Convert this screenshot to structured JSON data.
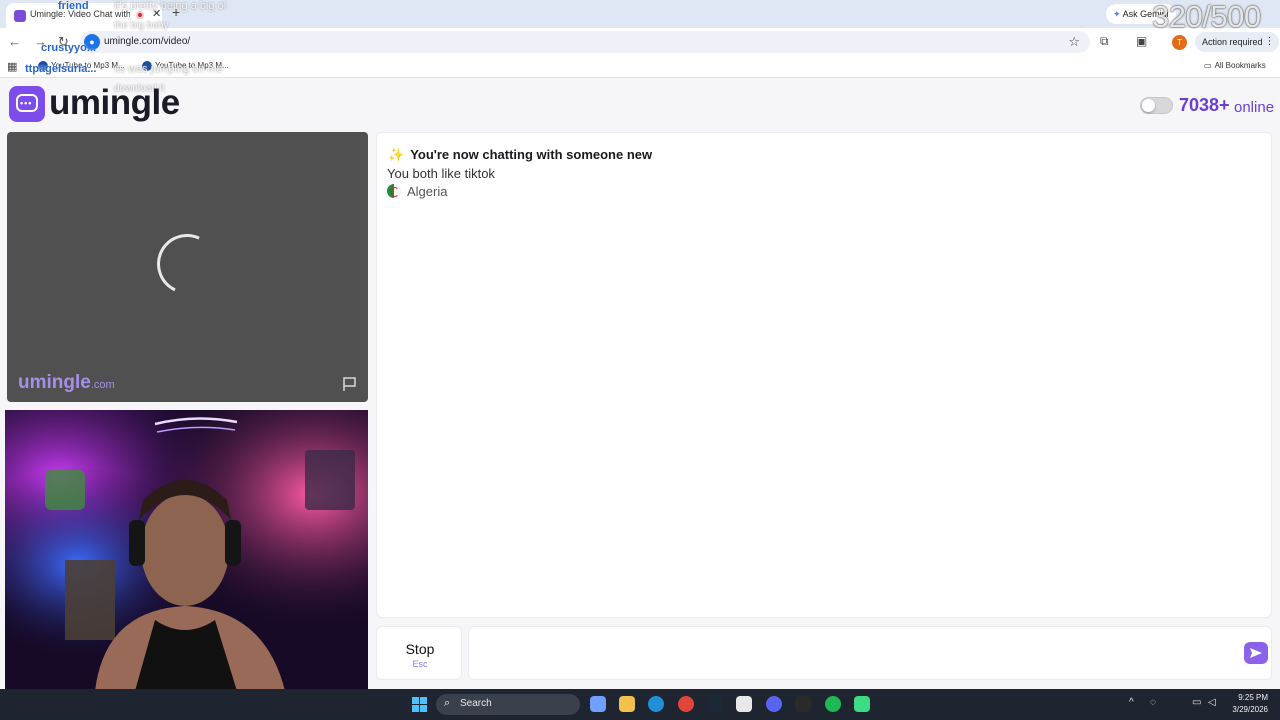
{
  "browser": {
    "tab_title": "Umingle: Video Chat with S",
    "new_tab_symbol": "+",
    "close_symbol": "✕",
    "url": "umingle.com/video/",
    "ask_gemini": "Ask Gemini",
    "action_required": "Action required",
    "bookmarks": [
      "YouTube to Mp3 M...",
      "YouTube to Mp3 M..."
    ],
    "all_bookmarks": "All Bookmarks"
  },
  "stream_overlay": {
    "counter": "320/500",
    "chat_lines": [
      {
        "name": "friend",
        "text": "it's pretty being a big ol"
      },
      {
        "name": "",
        "text": "the big baby"
      },
      {
        "name": "crustyyo...",
        "text": ""
      },
      {
        "name": "ttpagelsuria...",
        "text": "its was jumping on me"
      },
      {
        "name": "",
        "text": "download it"
      }
    ]
  },
  "site": {
    "logo_text": "umingle",
    "online_count": "7038+",
    "online_label": "online",
    "watermark_main": "umingle",
    "watermark_sub": ".com"
  },
  "chat": {
    "headline": "You're now chatting with someone new",
    "interest": "You both like tiktok",
    "country": "Algeria"
  },
  "controls": {
    "stop_label": "Stop",
    "stop_key": "Esc",
    "message_placeholder": ""
  },
  "taskbar": {
    "search_label": "Search",
    "time": "9:25 PM",
    "date": "3/29/2026"
  },
  "colors": {
    "brand": "#7c4dea",
    "online": "#6a3fd8"
  }
}
